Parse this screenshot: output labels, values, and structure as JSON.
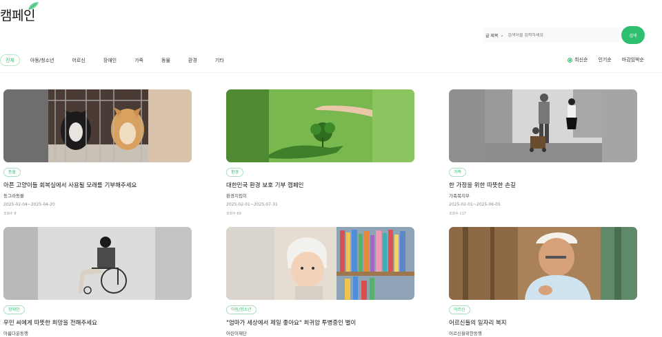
{
  "header": {
    "logo_text": "캠페인",
    "logo_icon": "leaf-icon"
  },
  "search": {
    "select_label": "글 제목",
    "placeholder": "검색어를 입력하세요",
    "button_label": "검색"
  },
  "categories": [
    "전체",
    "아동/청소년",
    "어르신",
    "장애인",
    "가족",
    "동물",
    "환경",
    "기타"
  ],
  "active_category": "전체",
  "sorts": [
    "최신순",
    "인기순",
    "마감임박순"
  ],
  "active_sort": "최신순",
  "colors": {
    "accent": "#2fbf71"
  },
  "campaigns": [
    {
      "tag": "동물",
      "title": "아픈 고양이들 회복실에서 사용될 모래를 기부해주세요",
      "org": "동그라동물",
      "date": "2025-02-04~2025-04-20",
      "views": "조회수 8"
    },
    {
      "tag": "환경",
      "title": "대한민국 환경 보호 기부 캠페인",
      "org": "환경지킴이",
      "date": "2025-02-01~2025-07-31",
      "views": "조회수 69"
    },
    {
      "tag": "가족",
      "title": "한 가정을 위한 따뜻한 손길",
      "org": "가족복지부",
      "date": "2025-02-01~2025-06-05",
      "views": "조회수 117"
    },
    {
      "tag": "장애인",
      "title": "우민 씨에게 따뜻한 희망을 전해주세요",
      "org": "아름다운동행",
      "date": "",
      "views": ""
    },
    {
      "tag": "아동/청소년",
      "title": "\"엄마가 세상에서 제일 좋아요\" 희귀암 투병중인 별이",
      "org": "어린이재단",
      "date": "",
      "views": ""
    },
    {
      "tag": "어르신",
      "title": "어르신들의 일자리 복지",
      "org": "어르신을위한동행",
      "date": "",
      "views": ""
    }
  ]
}
